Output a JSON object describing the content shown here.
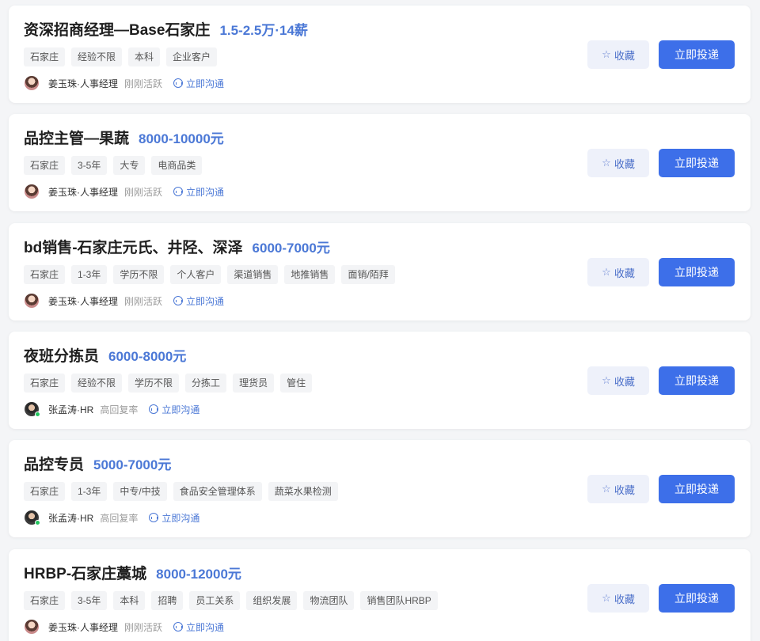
{
  "jobs": [
    {
      "title": "资深招商经理—Base石家庄",
      "salary": "1.5-2.5万·14薪",
      "tags": [
        "石家庄",
        "经验不限",
        "本科",
        "企业客户"
      ],
      "recruiter": "姜玉珠·人事经理",
      "status": "刚刚活跃",
      "avatar": "female-avatar",
      "online": false,
      "chat": "立即沟通",
      "fav": "收藏",
      "apply": "立即投递"
    },
    {
      "title": "品控主管—果蔬",
      "salary": "8000-10000元",
      "tags": [
        "石家庄",
        "3-5年",
        "大专",
        "电商品类"
      ],
      "recruiter": "姜玉珠·人事经理",
      "status": "刚刚活跃",
      "avatar": "female-avatar",
      "online": false,
      "chat": "立即沟通",
      "fav": "收藏",
      "apply": "立即投递"
    },
    {
      "title": "bd销售-石家庄元氏、井陉、深泽",
      "salary": "6000-7000元",
      "tags": [
        "石家庄",
        "1-3年",
        "学历不限",
        "个人客户",
        "渠道销售",
        "地推销售",
        "面销/陌拜"
      ],
      "recruiter": "姜玉珠·人事经理",
      "status": "刚刚活跃",
      "avatar": "female-avatar",
      "online": false,
      "chat": "立即沟通",
      "fav": "收藏",
      "apply": "立即投递"
    },
    {
      "title": "夜班分拣员",
      "salary": "6000-8000元",
      "tags": [
        "石家庄",
        "经验不限",
        "学历不限",
        "分拣工",
        "理货员",
        "管住"
      ],
      "recruiter": "张孟涛·HR",
      "status": "高回复率",
      "avatar": "male-avatar",
      "online": true,
      "chat": "立即沟通",
      "fav": "收藏",
      "apply": "立即投递"
    },
    {
      "title": "品控专员",
      "salary": "5000-7000元",
      "tags": [
        "石家庄",
        "1-3年",
        "中专/中技",
        "食品安全管理体系",
        "蔬菜水果检测"
      ],
      "recruiter": "张孟涛·HR",
      "status": "高回复率",
      "avatar": "male-avatar",
      "online": true,
      "chat": "立即沟通",
      "fav": "收藏",
      "apply": "立即投递"
    },
    {
      "title": "HRBP-石家庄藁城",
      "salary": "8000-12000元",
      "tags": [
        "石家庄",
        "3-5年",
        "本科",
        "招聘",
        "员工关系",
        "组织发展",
        "物流团队",
        "销售团队HRBP"
      ],
      "recruiter": "姜玉珠·人事经理",
      "status": "刚刚活跃",
      "avatar": "female-avatar",
      "online": false,
      "chat": "立即沟通",
      "fav": "收藏",
      "apply": "立即投递"
    }
  ],
  "colors": {
    "accent": "#3d6fe9",
    "salary": "#4b78d6",
    "online": "#22c55e"
  },
  "icons": {
    "fav": "star-icon",
    "chat": "chat-bubble-icon"
  }
}
